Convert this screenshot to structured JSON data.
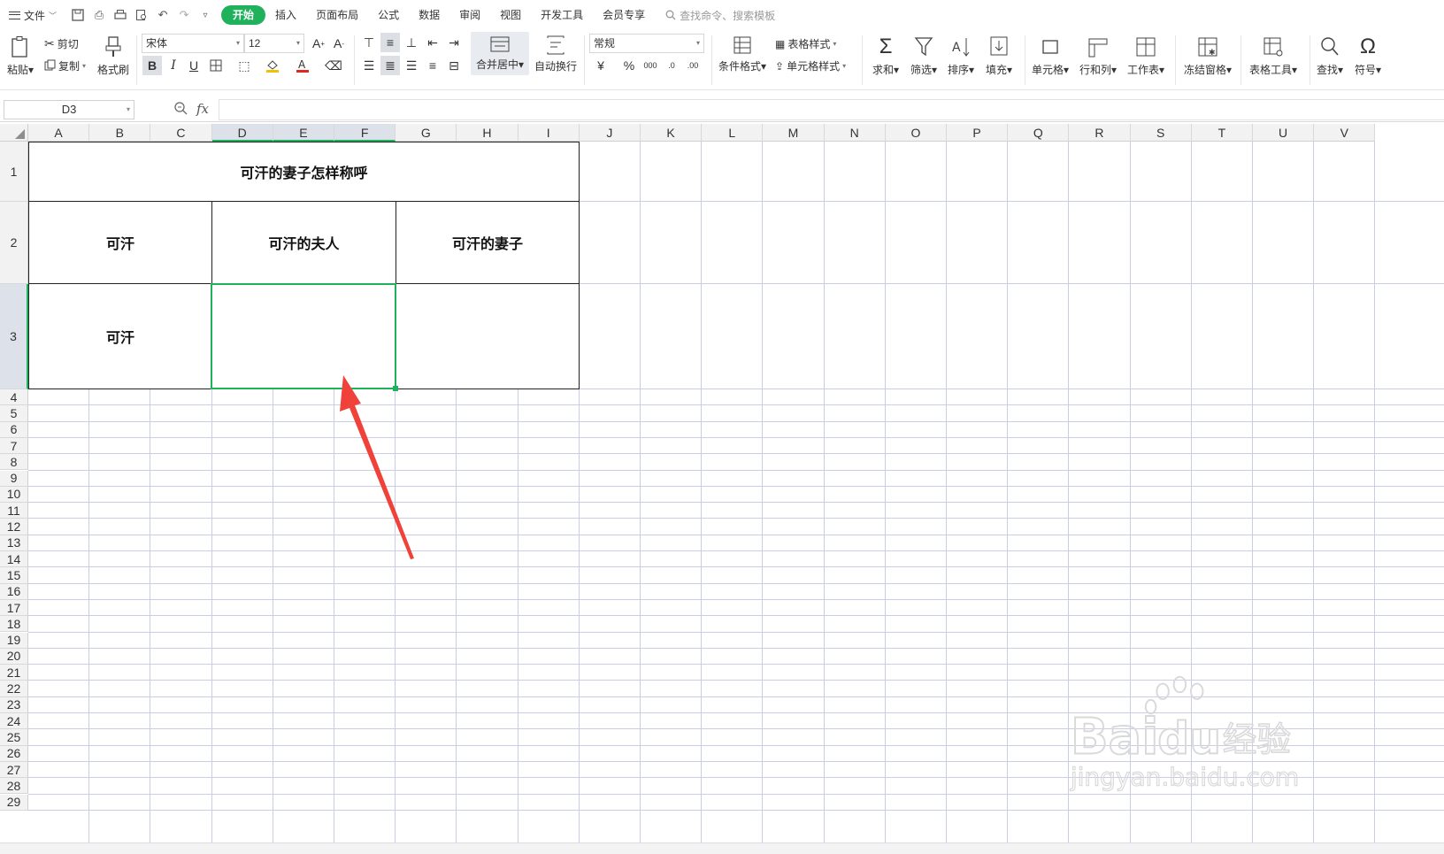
{
  "menubar": {
    "file_label": "文件",
    "tabs": [
      {
        "label": "开始",
        "active": true
      },
      {
        "label": "插入",
        "active": false
      },
      {
        "label": "页面布局",
        "active": false
      },
      {
        "label": "公式",
        "active": false
      },
      {
        "label": "数据",
        "active": false
      },
      {
        "label": "审阅",
        "active": false
      },
      {
        "label": "视图",
        "active": false
      },
      {
        "label": "开发工具",
        "active": false
      },
      {
        "label": "会员专享",
        "active": false
      }
    ],
    "search_placeholder": "查找命令、搜索模板"
  },
  "ribbon": {
    "paste": "粘贴",
    "cut": "剪切",
    "copy": "复制",
    "format_painter": "格式刷",
    "font_name": "宋体",
    "font_size": "12",
    "merge_center": "合并居中",
    "wrap_text": "自动换行",
    "number_format": "常规",
    "conditional_format": "条件格式",
    "table_style": "表格样式",
    "cell_style": "单元格样式",
    "sum": "求和",
    "filter": "筛选",
    "sort": "排序",
    "fill": "填充",
    "cell": "单元格",
    "row_col": "行和列",
    "worksheet": "工作表",
    "freeze": "冻结窗格",
    "table_tools": "表格工具",
    "find": "查找",
    "symbol": "符号"
  },
  "formula_bar": {
    "name_box": "D3",
    "fx": "fx",
    "value": ""
  },
  "grid": {
    "columns": [
      "A",
      "B",
      "C",
      "D",
      "E",
      "F",
      "G",
      "H",
      "I",
      "J",
      "K",
      "L",
      "M",
      "N",
      "O",
      "P",
      "Q",
      "R",
      "S",
      "T",
      "U",
      "V"
    ],
    "selected_column_group": [
      "D",
      "E",
      "F"
    ],
    "selected_row": "3",
    "rows": [
      "1",
      "2",
      "3",
      "4",
      "5",
      "6",
      "7",
      "8",
      "9",
      "10",
      "11",
      "12",
      "13",
      "14",
      "15",
      "16",
      "17",
      "18",
      "19",
      "20",
      "21",
      "22",
      "23",
      "24",
      "25",
      "26",
      "27",
      "28",
      "29"
    ]
  },
  "table": {
    "title": "可汗的妻子怎样称呼",
    "header_1": "可汗",
    "header_2": "可汗的夫人",
    "header_3": "可汗的妻子",
    "row3_col1": "可汗",
    "row3_col2": "",
    "row3_col3": ""
  },
  "colors": {
    "accent": "#1fb15b",
    "arrow": "#f0413a",
    "gridline": "#c9cde6"
  },
  "watermark": {
    "brand": "Baidu经验",
    "url": "jingyan.baidu.com"
  }
}
